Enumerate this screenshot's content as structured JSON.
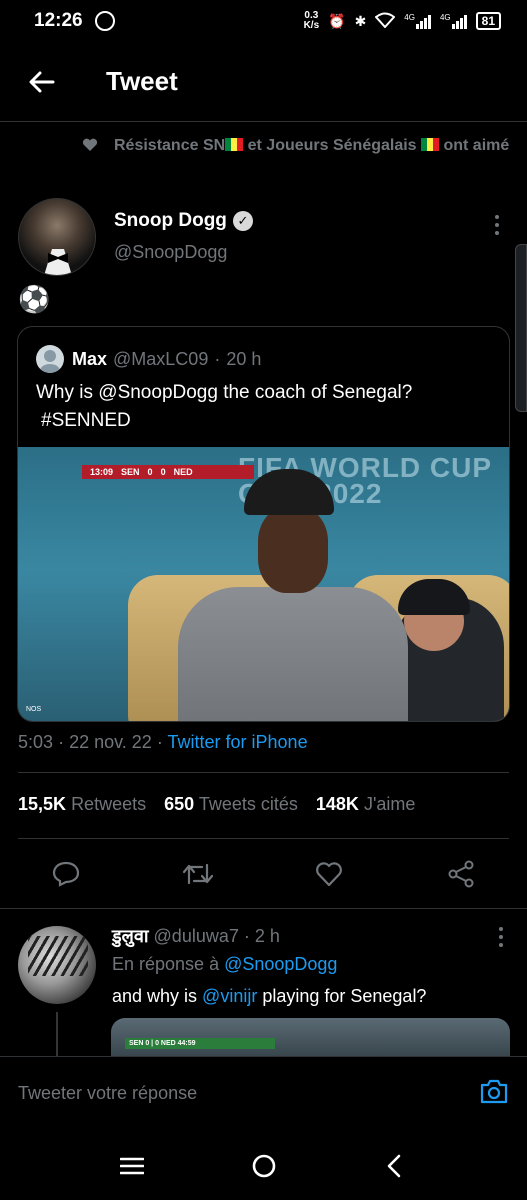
{
  "status_bar": {
    "time": "12:26",
    "net_speed_value": "0.3",
    "net_speed_unit": "K/s",
    "signal1_label": "4G",
    "signal2_label": "4G",
    "battery": "81"
  },
  "header": {
    "title": "Tweet"
  },
  "liked_by": {
    "part1": "Résistance SN",
    "part2": " et Joueurs Sénégalais ",
    "part3": " ont aimé"
  },
  "tweet": {
    "author_name": "Snoop Dogg",
    "handle": "@SnoopDogg",
    "text": "⚽",
    "quote": {
      "name": "Max",
      "handle": "@MaxLC09",
      "dot": "·",
      "age": "20 h",
      "text_line1": "Why is @SnoopDogg the coach of Senegal?",
      "text_line2": "#SENNED",
      "media": {
        "score_time": "13:09",
        "score_team1": "SEN",
        "score_1": "0",
        "score_2": "0",
        "score_team2": "NED",
        "watermark": "FIFA WORLD CUP Qatar2022",
        "corner_logo": "NOS"
      }
    },
    "time": "5:03",
    "date": "22 nov. 22",
    "source": "Twitter for iPhone",
    "sep": "·",
    "stats": {
      "retweets_count": "15,5K",
      "retweets_label": "Retweets",
      "quotes_count": "650",
      "quotes_label": "Tweets cités",
      "likes_count": "148K",
      "likes_label": "J'aime"
    }
  },
  "reply": {
    "name": "डुलुवा",
    "handle": "@duluwa7",
    "dot": "·",
    "age": "2 h",
    "in_reply_prefix": "En réponse à ",
    "in_reply_handle": "@SnoopDogg",
    "text_prefix": "and why is ",
    "text_mention": "@vinijr",
    "text_suffix": " playing for Senegal?",
    "media_bug": "SEN 0 | 0 NED 44:59"
  },
  "compose": {
    "placeholder": "Tweeter votre réponse"
  },
  "colors": {
    "accent": "#1d9bf0",
    "muted": "#71767b",
    "background": "#000000",
    "border": "#2f3336"
  }
}
